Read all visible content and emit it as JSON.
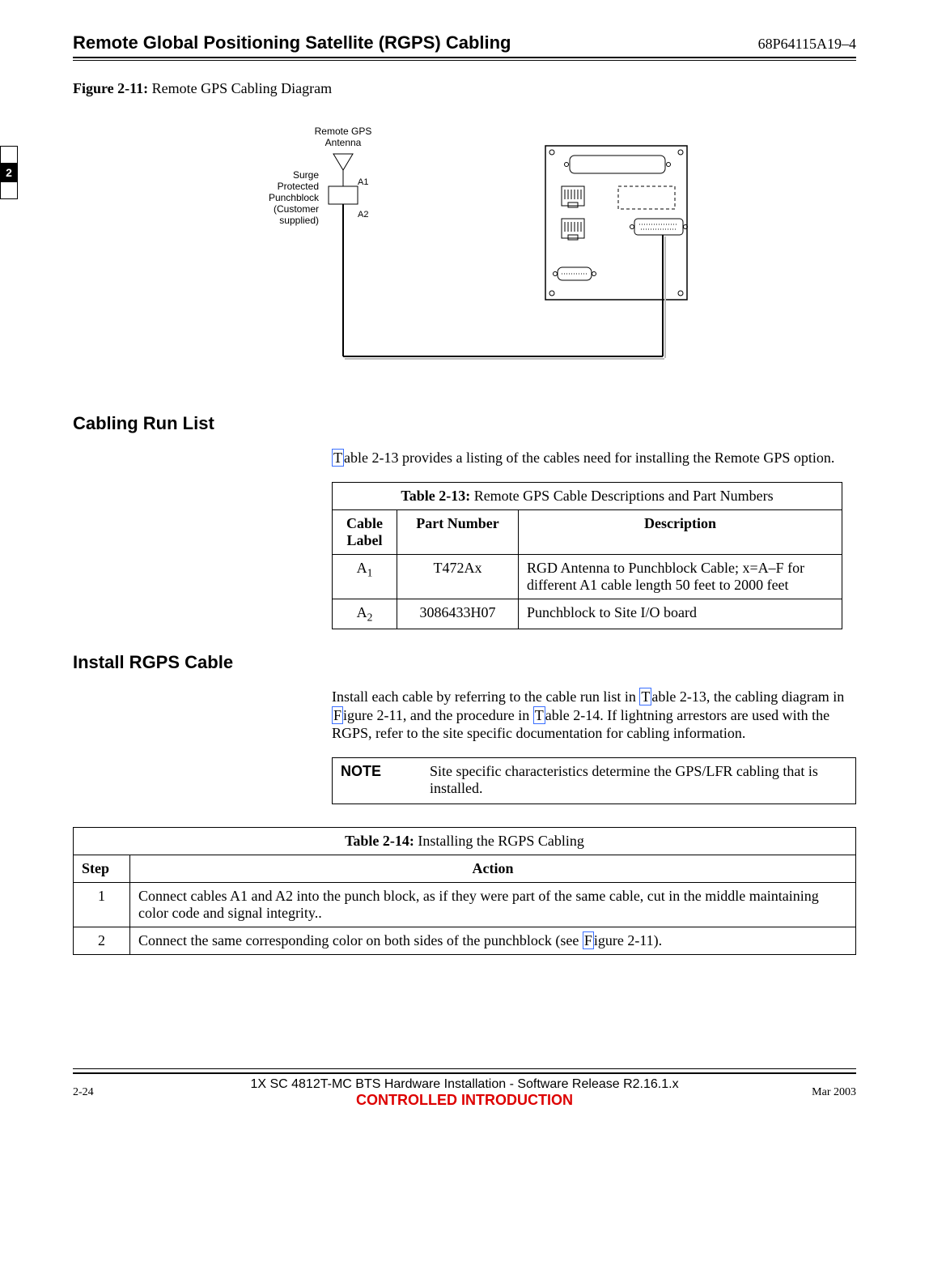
{
  "header": {
    "title": "Remote Global Positioning Satellite (RGPS) Cabling",
    "docnum": "68P64115A19–4"
  },
  "side_tab": "2",
  "figure": {
    "label": "Figure 2-11:",
    "caption": "Remote GPS Cabling Diagram",
    "antenna_label_line1": "Remote GPS",
    "antenna_label_line2": "Antenna",
    "punchblock_label_line1": "Surge",
    "punchblock_label_line2": "Protected",
    "punchblock_label_line3": "Punchblock",
    "punchblock_label_line4": "(Customer",
    "punchblock_label_line5": "supplied)",
    "a1": "A1",
    "a2": "A2"
  },
  "section1": {
    "heading": "Cabling Run List",
    "para_prefix": "T",
    "para_rest": "able 2-13 provides a listing of the cables need for installing the Remote GPS option."
  },
  "table213": {
    "title_bold": "Table 2-13:",
    "title_rest": " Remote GPS Cable Descriptions and Part Numbers",
    "col1": "Cable Label",
    "col2": "Part Number",
    "col3": "Description",
    "rows": [
      {
        "label_pre": "A",
        "label_sub": "1",
        "part": "T472Ax",
        "desc": "RGD Antenna to Punchblock Cable; x=A–F for different A1 cable length 50 feet to 2000 feet"
      },
      {
        "label_pre": "A",
        "label_sub": "2",
        "part": "3086433H07",
        "desc": "Punchblock to Site I/O board"
      }
    ]
  },
  "section2": {
    "heading": "Install RGPS Cable",
    "para_seg1": "Install each cable by referring to the cable run list in ",
    "link1": "T",
    "para_seg2": "able 2-13, the cabling diagram in ",
    "link2": "F",
    "para_seg3": "igure 2-11, and the procedure in ",
    "link3": "T",
    "para_seg4": "able 2-14. If lightning arrestors are used with the RGPS, refer to the site specific documentation for cabling information."
  },
  "note": {
    "label": "NOTE",
    "text": "Site specific characteristics determine the GPS/LFR cabling that is installed."
  },
  "table214": {
    "title_bold": "Table 2-14:",
    "title_rest": " Installing the RGPS Cabling",
    "col1": "Step",
    "col2": "Action",
    "rows": [
      {
        "step": "1",
        "action_pre": "Connect cables A1 and A2 into the punch block, as if they were part of the same cable, cut in the middle maintaining color code and signal integrity..",
        "link": "",
        "action_post": ""
      },
      {
        "step": "2",
        "action_pre": "Connect the same corresponding color on both sides of the punchblock (see ",
        "link": "F",
        "action_post": "igure 2-11)."
      }
    ]
  },
  "footer": {
    "pagenum": "2-24",
    "center_line1": "1X SC 4812T-MC BTS Hardware Installation - Software Release R2.16.1.x",
    "center_line2": "CONTROLLED INTRODUCTION",
    "date": "Mar 2003"
  }
}
